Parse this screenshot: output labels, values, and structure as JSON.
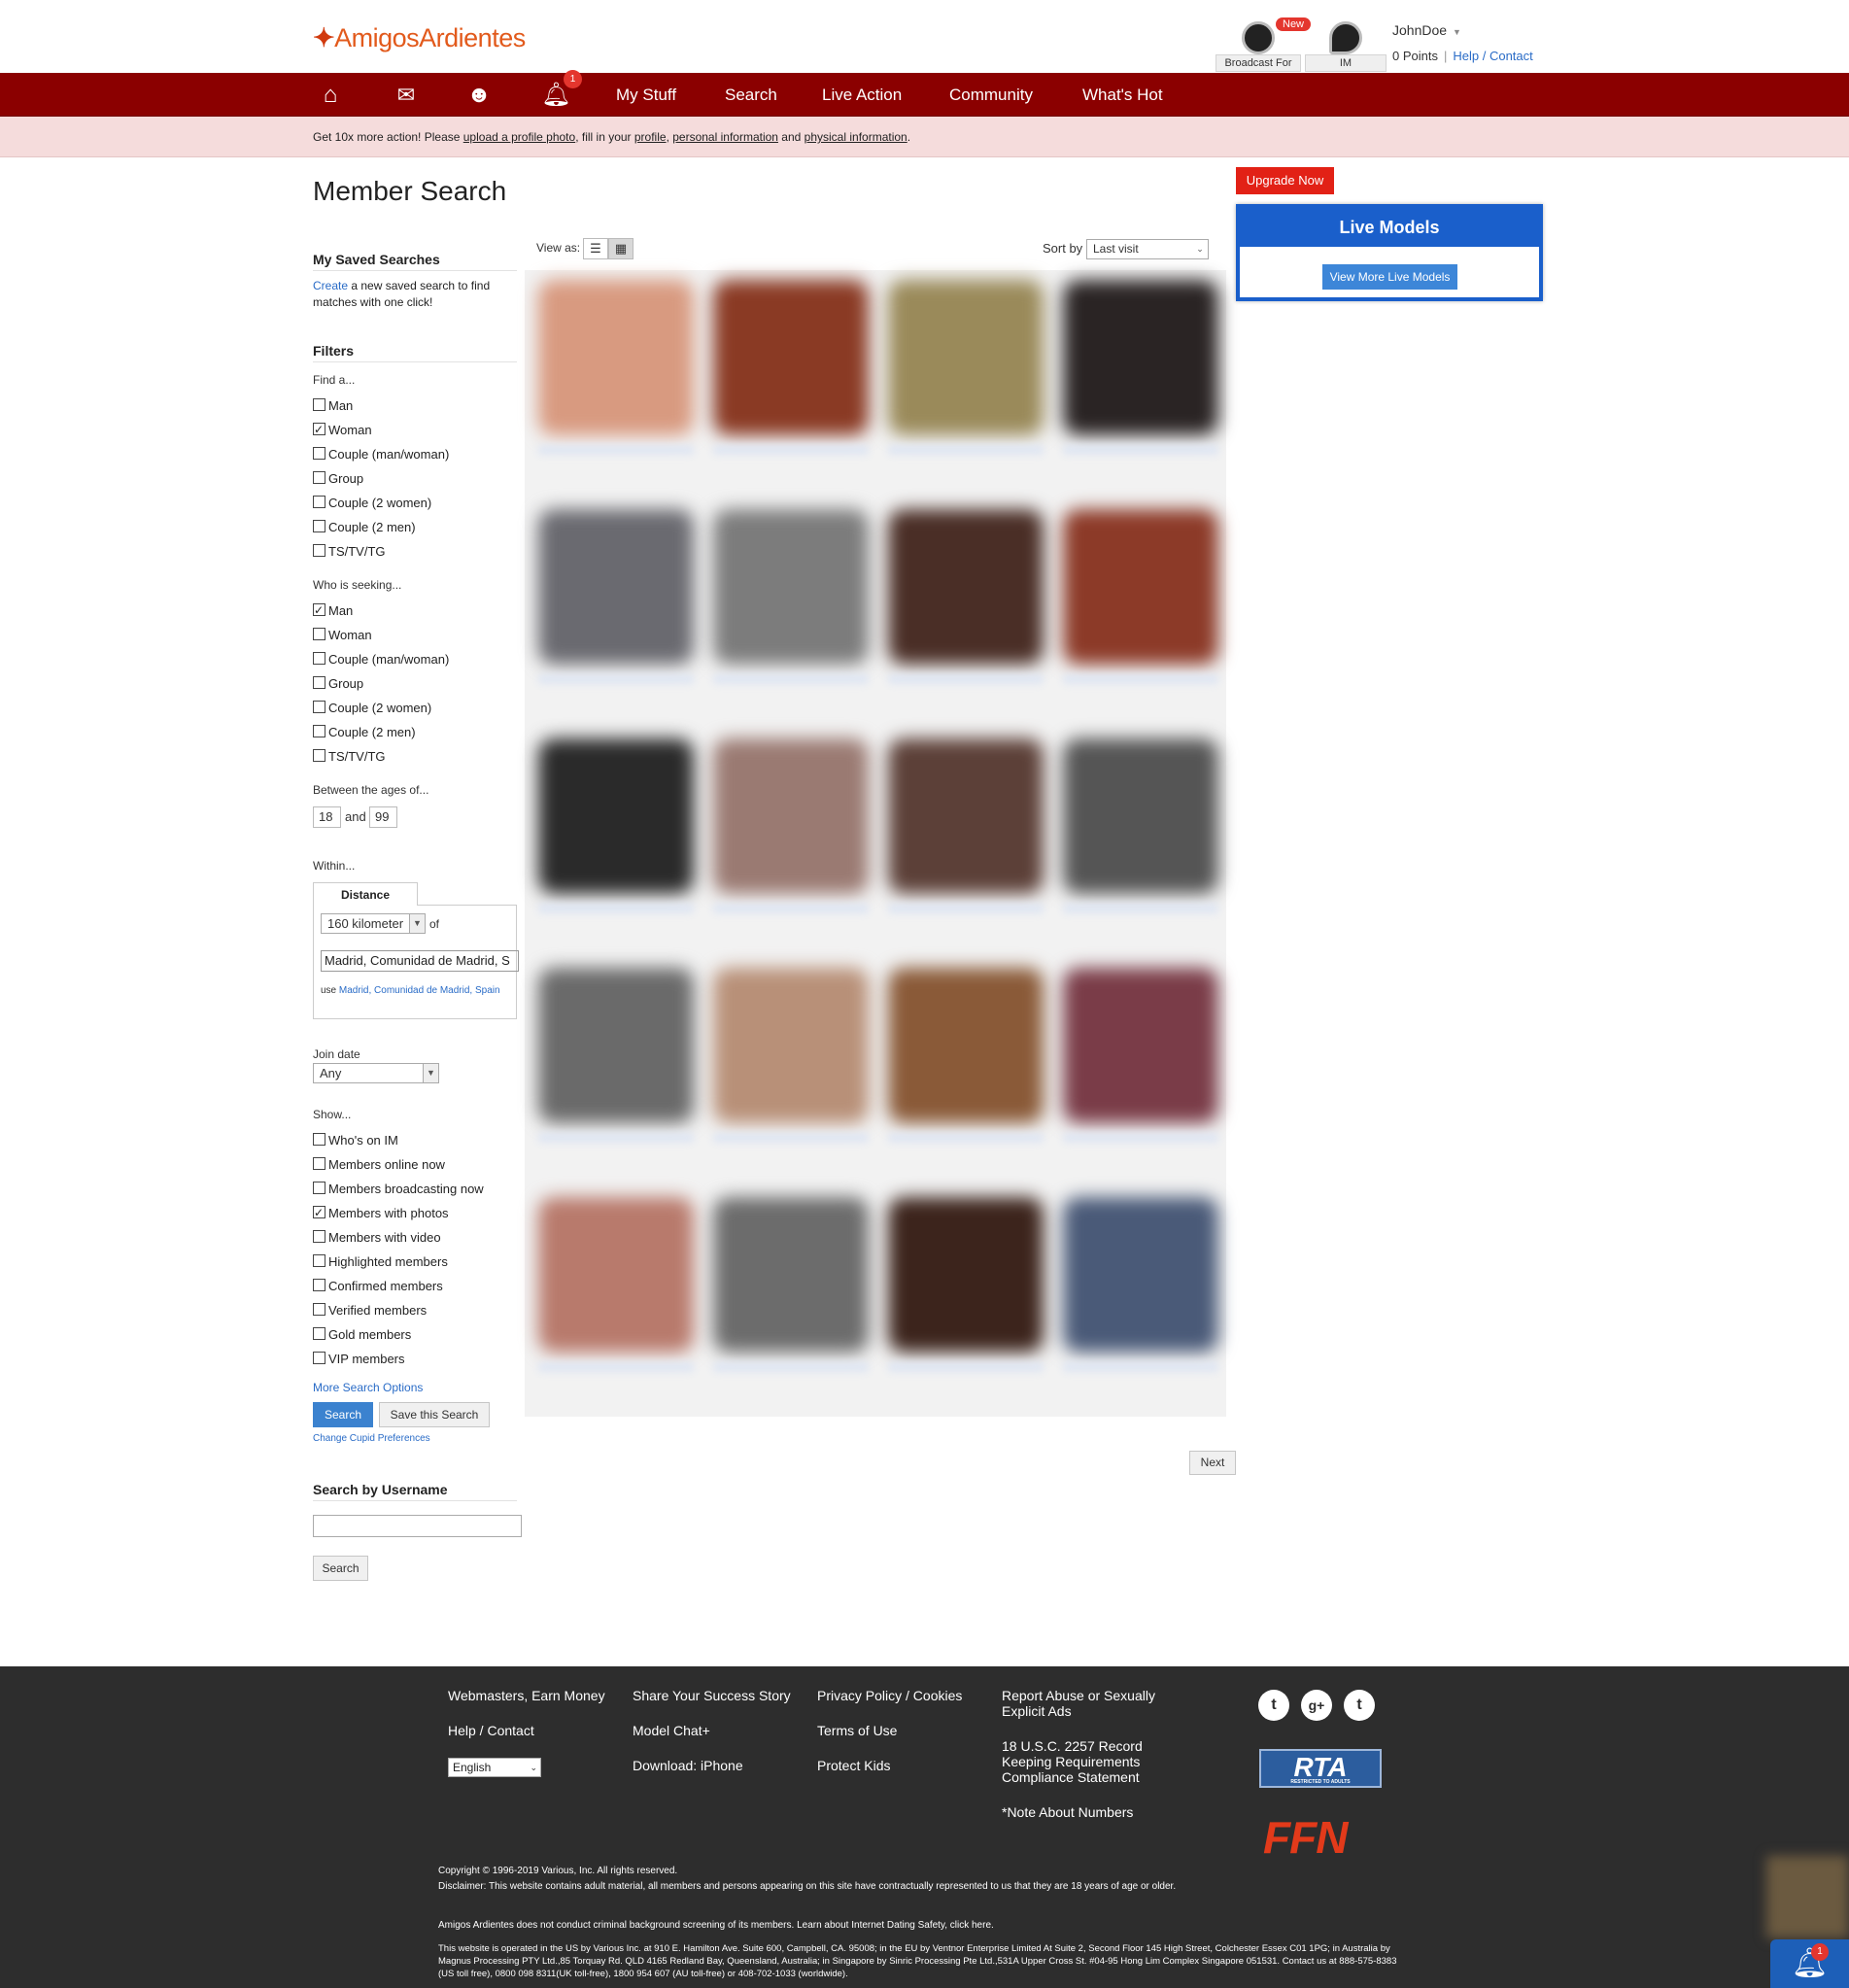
{
  "header": {
    "logo": "AmigosArdientes",
    "broadcast_label": "Broadcast For Tips",
    "broadcast_badge": "New",
    "im_label": "IM",
    "username": "JohnDoe",
    "points": "0 Points",
    "help_contact": "Help / Contact"
  },
  "nav": {
    "bell_badge": "1",
    "links": [
      "My Stuff",
      "Search",
      "Live Action",
      "Community",
      "What's Hot"
    ]
  },
  "notice": {
    "prefix": "Get 10x more action! Please ",
    "link1": "upload a profile photo",
    "mid1": ", fill in your ",
    "link2": "profile",
    "mid2": ", ",
    "link3": "personal information",
    "mid3": " and ",
    "link4": "physical information",
    "suffix": "."
  },
  "page_title": "Member Search",
  "upgrade_label": "Upgrade Now",
  "live_models": {
    "title": "Live Models",
    "button": "View More Live Models"
  },
  "saved_searches": {
    "heading": "My Saved Searches",
    "create_link": "Create",
    "text": " a new saved search to find matches with one click!"
  },
  "filters": {
    "heading": "Filters",
    "find_label": "Find a...",
    "find_options": [
      {
        "label": "Man",
        "checked": false
      },
      {
        "label": "Woman",
        "checked": true
      },
      {
        "label": "Couple (man/woman)",
        "checked": false
      },
      {
        "label": "Group",
        "checked": false
      },
      {
        "label": "Couple (2 women)",
        "checked": false
      },
      {
        "label": "Couple (2 men)",
        "checked": false
      },
      {
        "label": "TS/TV/TG",
        "checked": false
      }
    ],
    "seeking_label": "Who is seeking...",
    "seeking_options": [
      {
        "label": "Man",
        "checked": true
      },
      {
        "label": "Woman",
        "checked": false
      },
      {
        "label": "Couple (man/woman)",
        "checked": false
      },
      {
        "label": "Group",
        "checked": false
      },
      {
        "label": "Couple (2 women)",
        "checked": false
      },
      {
        "label": "Couple (2 men)",
        "checked": false
      },
      {
        "label": "TS/TV/TG",
        "checked": false
      }
    ],
    "ages_label": "Between the ages of...",
    "age_min": "18",
    "age_and": "and",
    "age_max": "99",
    "within_label": "Within...",
    "distance_tab": "Distance",
    "distance_value": "160 kilometer",
    "of_label": "of",
    "location_value": "Madrid, Comunidad de Madrid, S",
    "use_prefix": "use",
    "use_link": "Madrid, Comunidad de Madrid, Spain",
    "join_label": "Join date",
    "join_value": "Any",
    "show_label": "Show...",
    "show_options": [
      {
        "label": "Who's on IM",
        "checked": false
      },
      {
        "label": "Members online now",
        "checked": false
      },
      {
        "label": "Members broadcasting now",
        "checked": false
      },
      {
        "label": "Members with photos",
        "checked": true
      },
      {
        "label": "Members with video",
        "checked": false
      },
      {
        "label": "Highlighted members",
        "checked": false
      },
      {
        "label": "Confirmed members",
        "checked": false
      },
      {
        "label": "Verified members",
        "checked": false
      },
      {
        "label": "Gold members",
        "checked": false
      },
      {
        "label": "VIP members",
        "checked": false
      }
    ],
    "more_options": "More Search Options",
    "search_button": "Search",
    "save_button": "Save this Search",
    "cupid_link": "Change Cupid Preferences"
  },
  "username_search": {
    "heading": "Search by Username",
    "button": "Search"
  },
  "results": {
    "view_as": "View as:",
    "sort_by": "Sort by",
    "sort_value": "Last visit",
    "next": "Next",
    "photo_colors": [
      "#d89a80",
      "#8a3a24",
      "#9a8a5a",
      "#2a2424",
      "#6a6a70",
      "#7c7c7c",
      "#4a2e26",
      "#8c3a28",
      "#2a2a2a",
      "#9a7a72",
      "#5c4038",
      "#555555",
      "#6a6a6a",
      "#b89078",
      "#8a5a38",
      "#7a3c48",
      "#b87a6c",
      "#6c6c6c",
      "#3c241c",
      "#4a5a78"
    ]
  },
  "footer": {
    "col1": [
      "Webmasters, Earn Money",
      "Help / Contact"
    ],
    "col2": [
      "Share Your Success Story",
      "Model Chat+",
      "Download: iPhone"
    ],
    "col3": [
      "Privacy Policy / Cookies",
      "Terms of Use",
      "Protect Kids"
    ],
    "col4": [
      "Report Abuse or Sexually Explicit Ads",
      "18 U.S.C. 2257 Record Keeping Requirements Compliance Statement",
      "*Note About Numbers"
    ],
    "language": "English",
    "rta": "RTA",
    "rta_sub": "RESTRICTED TO ADULTS",
    "ffn": "FFN",
    "copyright": "Copyright © 1996-2019 Various, Inc. All rights reserved.",
    "disclaimer": "Disclaimer: This website contains adult material, all members and persons appearing on this site have contractually represented to us that they are 18 years of age or older.",
    "screening": "Amigos Ardientes does not conduct criminal background screening of its members. Learn about Internet Dating Safety, click here.",
    "operated": "This website is operated in the US by Various Inc. at 910 E. Hamilton Ave. Suite 600, Campbell, CA. 95008; in the EU by Ventnor Enterprise Limited At Suite 2, Second Floor 145 High Street, Colchester Essex C01 1PG; in Australia by Magnus Processing PTY Ltd.,85 Torquay Rd. QLD 4165 Redland Bay, Queensland, Australia; in Singapore by Sinric Processing Pte Ltd.,531A Upper Cross St. #04-95 Hong Lim Complex Singapore 051531. Contact us at 888-575-8383 (US toll free), 0800 098 8311(UK toll-free), 1800 954 607 (AU toll-free) or 408-702-1033 (worldwide).",
    "float_badge": "1"
  }
}
